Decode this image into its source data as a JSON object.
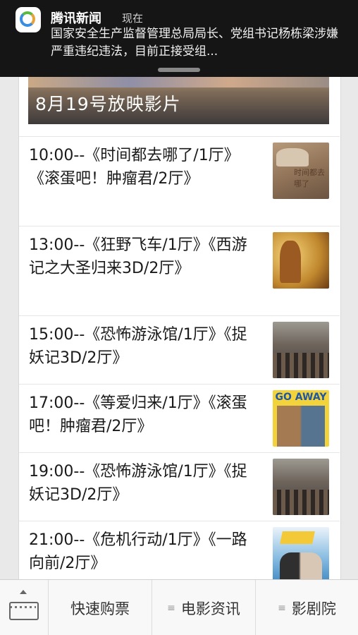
{
  "notification": {
    "app_name": "腾讯新闻",
    "time": "现在",
    "message": "国家安全生产监督管理总局局长、党组书记杨栋梁涉嫌严重违纪违法，目前正接受组..."
  },
  "banner": {
    "title": "8月19号放映影片"
  },
  "schedule": [
    {
      "text": "10:00--《时间都去哪了/1厅》《滚蛋吧！肿瘤君/2厅》",
      "thumb_text": "时间都去哪了"
    },
    {
      "text": "13:00--《狂野飞车/1厅》《西游记之大圣归来3D/2厅》"
    },
    {
      "text": "15:00--《恐怖游泳馆/1厅》《捉妖记3D/2厅》"
    },
    {
      "text": "17:00--《等爱归来/1厅》《滚蛋吧！肿瘤君/2厅》",
      "thumb_text": "GO AWAY"
    },
    {
      "text": "19:00--《恐怖游泳馆/1厅》《捉妖记3D/2厅》"
    },
    {
      "text": "21:00--《危机行动/1厅》《一路向前/2厅》"
    }
  ],
  "bottom_bar": {
    "buy": "快速购票",
    "news": "电影资讯",
    "theater": "影剧院",
    "menu_glyph": "≡"
  }
}
